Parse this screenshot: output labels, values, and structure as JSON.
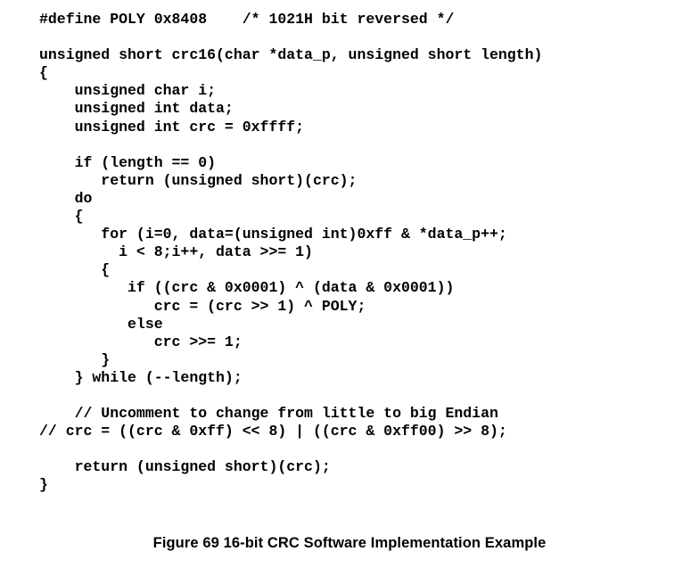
{
  "figure": {
    "caption": "Figure 69 16-bit CRC Software Implementation Example",
    "background_color": "#ffffff",
    "text_color": "#000000"
  },
  "code": {
    "language": "C",
    "lines": [
      "#define POLY 0x8408    /* 1021H bit reversed */",
      "",
      "unsigned short crc16(char *data_p, unsigned short length)",
      "{",
      "    unsigned char i;",
      "    unsigned int data;",
      "    unsigned int crc = 0xffff;",
      "",
      "    if (length == 0)",
      "       return (unsigned short)(crc);",
      "    do",
      "    {",
      "       for (i=0, data=(unsigned int)0xff & *data_p++;",
      "         i < 8;i++, data >>= 1)",
      "       {",
      "          if ((crc & 0x0001) ^ (data & 0x0001))",
      "             crc = (crc >> 1) ^ POLY;",
      "          else",
      "             crc >>= 1;",
      "       }",
      "    } while (--length);",
      "",
      "    // Uncomment to change from little to big Endian",
      "// crc = ((crc & 0xff) << 8) | ((crc & 0xff00) >> 8);",
      "",
      "    return (unsigned short)(crc);",
      "}"
    ]
  }
}
